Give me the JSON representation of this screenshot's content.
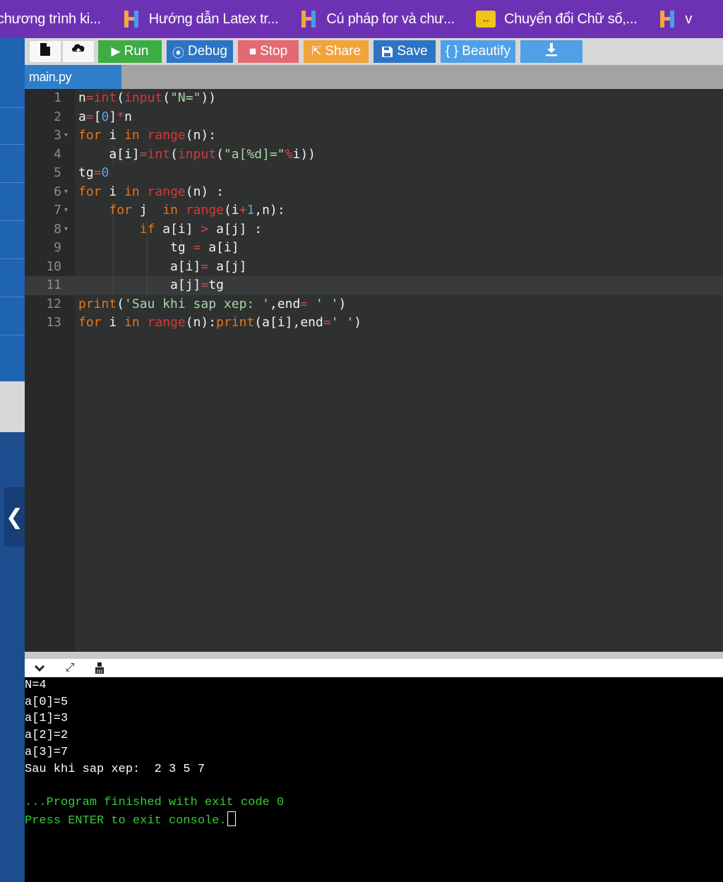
{
  "bookmarks": [
    {
      "label": "chương trình ki...",
      "icon": "none"
    },
    {
      "label": "Hướng dẫn Latex tr...",
      "icon": "h-logo-icon"
    },
    {
      "label": "Cú pháp for và chư...",
      "icon": "h-logo-icon"
    },
    {
      "label": "Chuyển đổi Chữ số,...",
      "icon": "swap-arrows-icon"
    },
    {
      "label": "v",
      "icon": "h-logo-icon"
    }
  ],
  "toolbar": {
    "run": "Run",
    "debug": "Debug",
    "stop": "Stop",
    "share": "Share",
    "save": "Save",
    "beautify": "{ } Beautify"
  },
  "tabs": [
    {
      "label": "main.py"
    }
  ],
  "editor": {
    "line_numbers": [
      "1",
      "2",
      "3",
      "4",
      "5",
      "6",
      "7",
      "8",
      "9",
      "10",
      "11",
      "12",
      "13"
    ],
    "lines": [
      "n=int(input(\"N=\"))",
      "a=[0]*n",
      "for i in range(n):",
      "    a[i]=int(input(\"a[%d]=\"%i))",
      "tg=0",
      "for i in range(n) :",
      "    for j  in range(i+1,n):",
      "        if a[i] > a[j] :",
      "            tg = a[i]",
      "            a[i]= a[j]",
      "            a[j]=tg",
      "print('Sau khi sap xep: ',end= ' ')",
      "for i in range(n):print(a[i],end=' ')"
    ],
    "active_line": 11
  },
  "console": {
    "lines": [
      "N=4",
      "a[0]=5",
      "a[1]=3",
      "a[2]=2",
      "a[3]=7",
      "Sau khi sap xep:  2 3 5 7",
      "",
      "...Program finished with exit code 0",
      "Press ENTER to exit console."
    ]
  },
  "colors": {
    "bookmark_bar": "#6d32b4",
    "sidebar": "#1f63b3",
    "run": "#3eac45",
    "debug": "#2d74c4",
    "stop": "#e36a72",
    "share": "#f2a33a",
    "editor_bg": "#2f3030",
    "console_bg": "#000000"
  }
}
